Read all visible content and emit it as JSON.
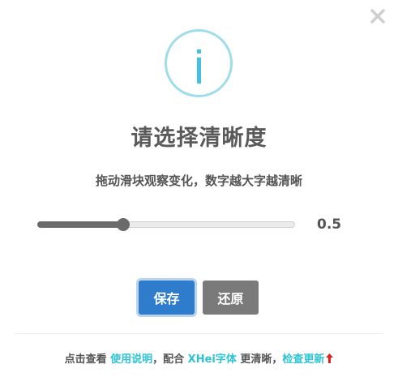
{
  "dialog": {
    "title": "请选择清晰度",
    "subtitle": "拖动滑块观察变化，数字越大字越清晰"
  },
  "slider": {
    "value": 0.5,
    "value_label": "0.5",
    "min": 0,
    "max": 1.5
  },
  "buttons": {
    "save_label": "保存",
    "restore_label": "还原"
  },
  "footer": {
    "text_1": "点击查看 ",
    "link_usage": "使用说明",
    "text_2": "，配合 ",
    "link_font": "XHei字体",
    "text_3": " 更清晰，",
    "link_update": "检查更新"
  },
  "icons": {
    "close": "close-icon",
    "info": "info-icon",
    "update_arrow": "arrow-up-icon"
  },
  "colors": {
    "info_circle": "#9fdcec",
    "info_glyph": "#46bfe4",
    "save_button": "#2f7ccc",
    "restore_button": "#7a7a7a",
    "link": "#2ec3d4",
    "update_arrow": "#e02020",
    "slider_fill": "#6b6b6b"
  }
}
